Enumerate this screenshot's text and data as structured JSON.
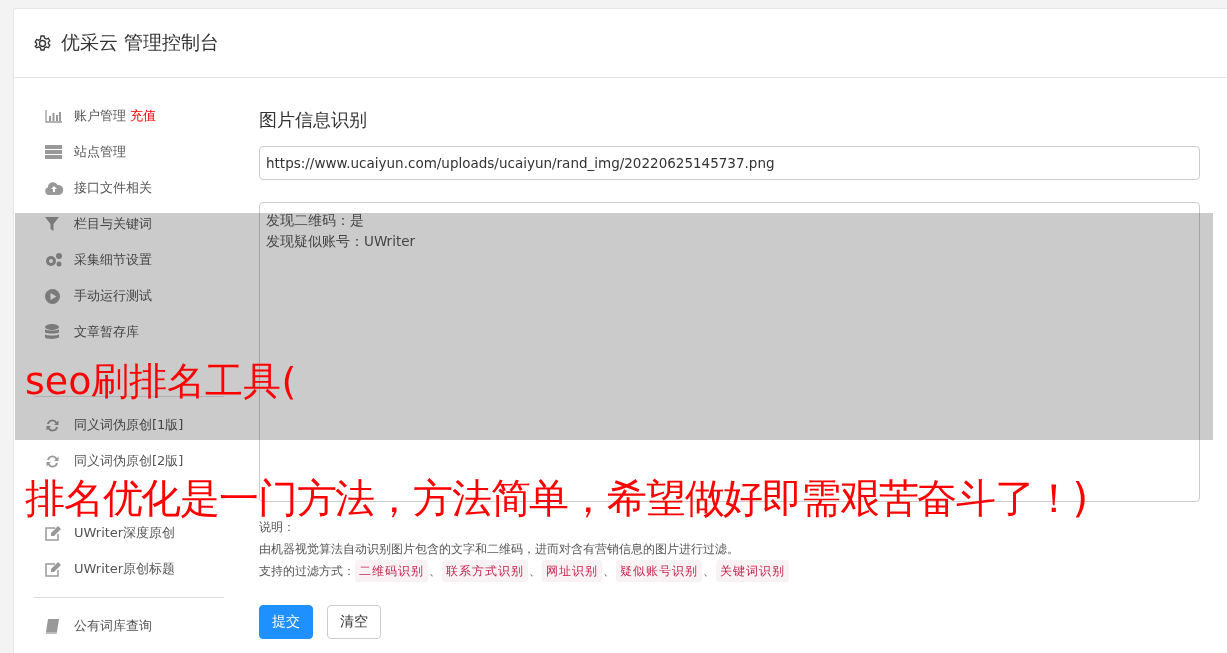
{
  "header": {
    "title": "优采云 管理控制台"
  },
  "sidebar": {
    "items": [
      {
        "kind": "item",
        "label": "账户管理",
        "badge": "充值"
      },
      {
        "kind": "item",
        "label": "站点管理"
      },
      {
        "kind": "item",
        "label": "接口文件相关"
      },
      {
        "kind": "item",
        "label": "栏目与关键词"
      },
      {
        "kind": "item",
        "label": "采集细节设置"
      },
      {
        "kind": "item",
        "label": "手动运行测试"
      },
      {
        "kind": "item",
        "label": "文章暂存库"
      },
      {
        "kind": "covered"
      },
      {
        "kind": "divider"
      },
      {
        "kind": "item",
        "label": "同义词伪原创[1版]"
      },
      {
        "kind": "item",
        "label": "同义词伪原创[2版]"
      },
      {
        "kind": "covered"
      },
      {
        "kind": "item",
        "label": "UWriter深度原创"
      },
      {
        "kind": "item",
        "label": "UWriter原创标题"
      },
      {
        "kind": "divider"
      },
      {
        "kind": "item",
        "label": "公有词库查询"
      }
    ]
  },
  "main": {
    "title": "图片信息识别",
    "url_field": {
      "value": "https://www.ucaiyun.com/uploads/ucaiyun/rand_img/20220625145737.png"
    },
    "result_box": {
      "lines": [
        "发现二维码：是",
        "发现疑似账号：UWriter"
      ]
    },
    "note_label": "说明：",
    "description": "由机器视觉算法自动识别图片包含的文字和二维码，进而对含有营销信息的图片进行过滤。",
    "filters_label": "支持的过滤方式：",
    "filters": [
      "二维码识别",
      "联系方式识别",
      "网址识别",
      "疑似账号识别",
      "关键词识别"
    ],
    "separator": "、",
    "buttons": [
      {
        "label": "提交",
        "kind": "primary"
      },
      {
        "label": "清空",
        "kind": "default"
      }
    ]
  },
  "overlay": {
    "lines": [
      "seo刷排名工具(",
      "排名优化是一门方法，方法简单，希望做好即需艰苦奋斗了！)"
    ]
  }
}
